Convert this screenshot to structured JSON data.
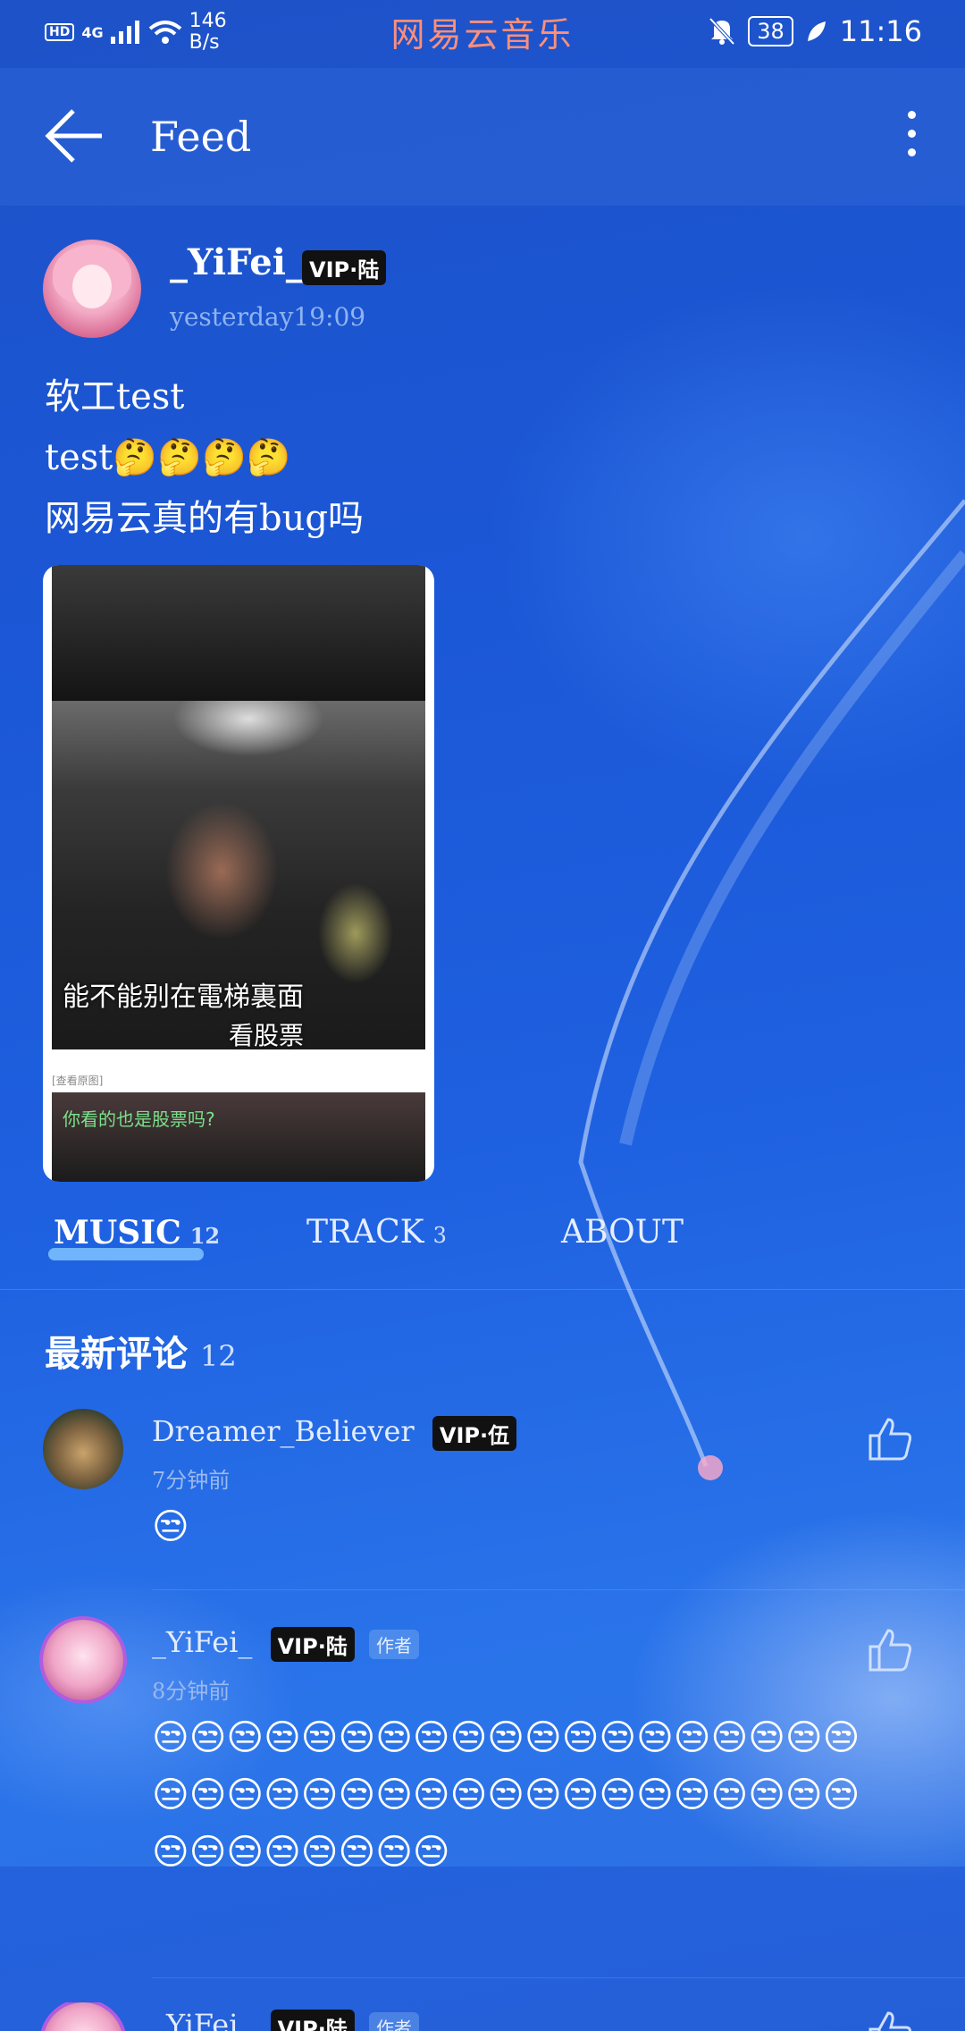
{
  "status_bar": {
    "network_hd": "HD",
    "network_type": "4G",
    "speed_value": "146",
    "speed_unit": "B/s",
    "app_name": "网易云音乐",
    "battery": "38",
    "time": "11:16"
  },
  "appbar": {
    "title": "Feed"
  },
  "post": {
    "username": "_YiFei_",
    "vip_badge": "VIP·陆",
    "time": "yesterday19:09",
    "lines": [
      "软工test",
      "test🤔🤔🤔🤔",
      "网易云真的有bug吗"
    ],
    "image": {
      "subtitle_1": "能不能别在電梯裏面",
      "subtitle_2": "看股票",
      "note": "[查看原图]",
      "subtitle_3": "你看的也是股票吗?"
    }
  },
  "tabs": [
    {
      "label": "MUSIC",
      "count": "12"
    },
    {
      "label": "TRACK",
      "count": "3"
    },
    {
      "label": "ABOUT",
      "count": ""
    }
  ],
  "comments_section": {
    "title": "最新评论",
    "count": "12",
    "items": [
      {
        "username": "Dreamer_Believer",
        "vip_badge": "VIP·伍",
        "time": "7分钟前",
        "body": "😒",
        "author_tag": ""
      },
      {
        "username": "_YiFei_",
        "vip_badge": "VIP·陆",
        "time": "8分钟前",
        "body": "😒😒😒😒😒😒😒😒😒😒😒😒😒😒😒😒😒😒😒😒😒😒😒😒😒😒😒😒😒😒😒😒😒😒😒😒😒😒😒😒😒😒😒😒😒😒",
        "author_tag": "作者"
      },
      {
        "username": "_YiFei_",
        "vip_badge": "VIP·陆",
        "time": "",
        "body": "",
        "author_tag": "作者"
      }
    ]
  },
  "colors": {
    "accent_underline": "#7fc3ff",
    "app_name_color": "#ff8f7a",
    "background": "#1e5ad8"
  }
}
